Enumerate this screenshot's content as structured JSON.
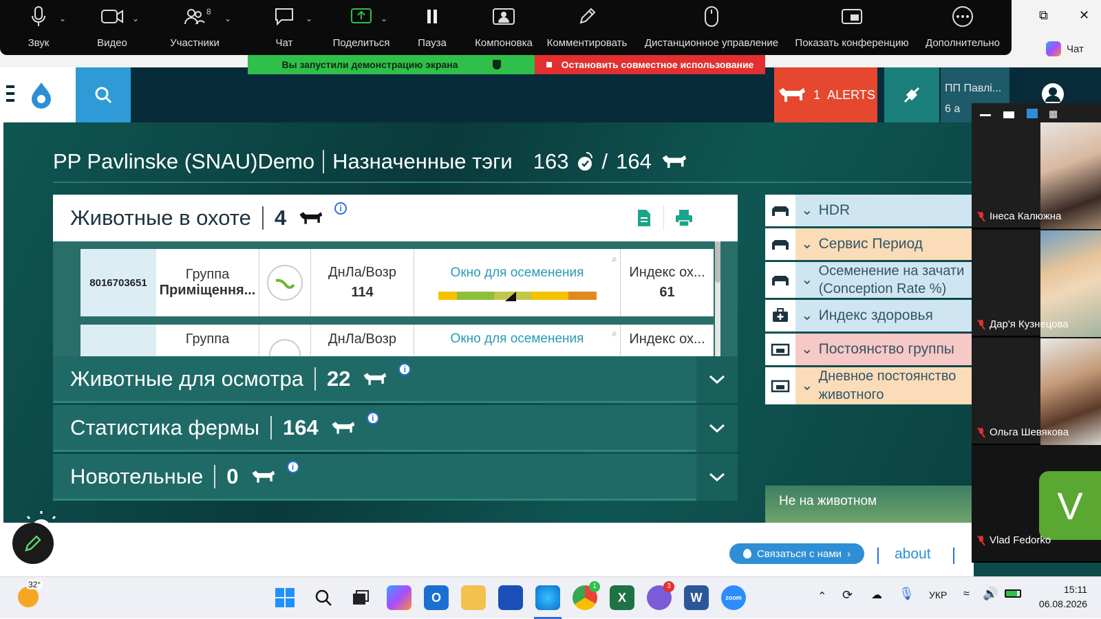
{
  "zoom_toolbar": {
    "items": [
      {
        "label": "Звук",
        "icon": "microphone-icon"
      },
      {
        "label": "Видео",
        "icon": "video-camera-icon"
      },
      {
        "label": "Участники",
        "icon": "participants-icon",
        "count": "8"
      },
      {
        "label": "Чат",
        "icon": "chat-icon"
      },
      {
        "label": "Поделиться",
        "icon": "share-screen-icon"
      },
      {
        "label": "Пауза",
        "icon": "pause-icon"
      },
      {
        "label": "Компоновка",
        "icon": "layout-icon"
      },
      {
        "label": "Комментировать",
        "icon": "pencil-icon"
      },
      {
        "label": "Дистанционное управление",
        "icon": "mouse-icon"
      },
      {
        "label": "Показать конференцию",
        "icon": "show-meeting-icon"
      },
      {
        "label": "Дополнительно",
        "icon": "more-icon"
      }
    ],
    "chat_button": "Чат"
  },
  "share_banner": {
    "active": "Вы запустили демонстрацию экрана",
    "stop": "Остановить совместное использование"
  },
  "topnav": {
    "alerts_count": "1",
    "alerts_label": "ALERTS",
    "farm_name": "ПП Павлі...",
    "farm_sub": "6 а"
  },
  "title": {
    "farm": "PP Pavlinske (SNAU)Demo",
    "section": "Назначенные тэги",
    "tags": "163",
    "separator": "/",
    "animals": "164"
  },
  "hunt_panel": {
    "title": "Животные в охоте",
    "count": "4",
    "cards": [
      {
        "id": "8016703651",
        "group_label": "Группа",
        "group_value": "Приміщення...",
        "dnla_label": "ДнЛа/Возр",
        "dnla_value": "114",
        "window_label": "Окно для осеменения",
        "index_label": "Индекс ох...",
        "index_value": "61"
      },
      {
        "id": "",
        "group_label": "Группа",
        "group_value": "",
        "dnla_label": "ДнЛа/Возр",
        "dnla_value": "",
        "window_label": "Окно для осеменения",
        "index_label": "Индекс ох...",
        "index_value": ""
      }
    ]
  },
  "panels": [
    {
      "title": "Животные для осмотра",
      "count": "22"
    },
    {
      "title": "Статистика фермы",
      "count": "164"
    },
    {
      "title": "Новотельные",
      "count": "0"
    }
  ],
  "right_list": [
    {
      "label": "HDR",
      "icon": "herd-icon",
      "color": "#cfe6f2"
    },
    {
      "label": "Сервис Период",
      "icon": "herd-icon",
      "color": "#fbdcb8"
    },
    {
      "label": "Осеменение на зачати (Conception Rate %)",
      "icon": "herd-icon",
      "color": "#cfe6f2"
    },
    {
      "label": "Индекс здоровья",
      "icon": "medkit-icon",
      "color": "#cfe6f2"
    },
    {
      "label": "Постоянство группы",
      "icon": "group-icon",
      "color": "#f7c9c6"
    },
    {
      "label": "Дневное постоянство животного",
      "icon": "group-icon",
      "color": "#fbdcb8"
    }
  ],
  "not_on_animal": "Не на животном",
  "footer": {
    "contact": "Связаться с нами",
    "about": "about"
  },
  "gallery": [
    {
      "name": "Інеса Калюжна"
    },
    {
      "name": "Дар'я Кузнецова"
    },
    {
      "name": "Ольга Шевякова"
    },
    {
      "name": "Vlad Fedorko",
      "initial": "V"
    }
  ],
  "taskbar": {
    "weather": "32°",
    "language": "УКР",
    "time": "15:11",
    "date": "06.08.2026",
    "chrome_badge": "1",
    "viber_badge": "3"
  },
  "colors": {
    "accent_green": "#2fbf4a",
    "alert_red": "#e5472f",
    "teal_panel": "#1f6a66",
    "link_blue": "#2e8fd6"
  }
}
